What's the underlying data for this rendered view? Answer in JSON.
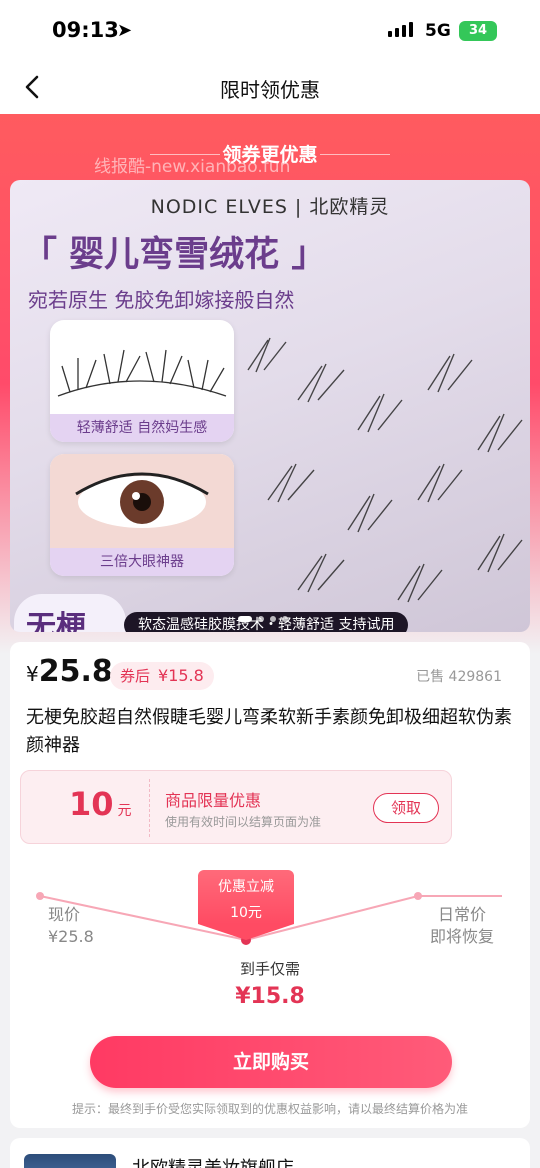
{
  "status_bar": {
    "time": "09:13",
    "network": "5G",
    "battery": "34"
  },
  "nav": {
    "title": "限时领优惠"
  },
  "hero": {
    "ribbon": "领券更优惠",
    "watermark": "线报酷-new.xianbao.fun"
  },
  "product_image": {
    "brand": "NODIC ELVES | 北欧精灵",
    "headline": "「 婴儿弯雪绒花 」",
    "subheadline": "宛若原生 免胶免卸嫁接般自然",
    "thumb1_caption": "轻薄舒适 自然妈生感",
    "thumb2_caption": "三倍大眼神器",
    "badge": "无梗",
    "feature_pill": "软态温感硅胶膜技术・轻薄舒适 支持试用"
  },
  "product": {
    "price_symbol": "¥",
    "price": "25.8",
    "after_label": "券后",
    "after_price": "¥15.8",
    "sold": "已售 429861",
    "title": "无梗免胶超自然假睫毛婴儿弯柔软新手素颜免卸极细超软伪素颜神器"
  },
  "coupon": {
    "amount": "10",
    "unit": "元",
    "title": "商品限量优惠",
    "subtitle": "使用有效时间以结算页面为准",
    "button": "领取"
  },
  "price_flow": {
    "bubble_line1": "优惠立减",
    "bubble_line2": "10元",
    "left_label": "现价",
    "left_value": "¥25.8",
    "right_line1": "日常价",
    "right_line2": "即将恢复",
    "final_label": "到手仅需",
    "final_price": "¥15.8"
  },
  "buy_button": "立即购买",
  "tip": "提示：最终到手价受您实际领取到的优惠权益影响，请以最终结算价格为准",
  "store": {
    "name": "北欧精灵美妆旗舰店"
  },
  "colors": {
    "accent": "#e33455",
    "hero_top": "#ff5b5f",
    "headline": "#6b3d8c"
  }
}
